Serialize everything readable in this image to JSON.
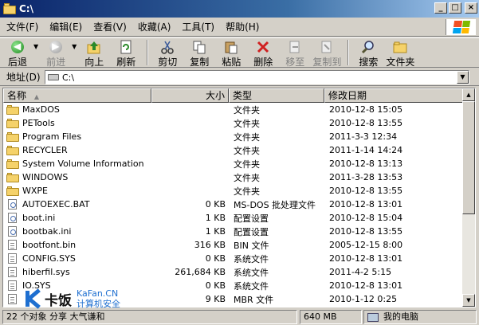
{
  "window": {
    "title": "C:\\"
  },
  "menu": [
    "文件(F)",
    "编辑(E)",
    "查看(V)",
    "收藏(A)",
    "工具(T)",
    "帮助(H)"
  ],
  "toolbar": {
    "back": "后退",
    "forward": "前进",
    "up": "向上",
    "refresh": "刷新",
    "cut": "剪切",
    "copy": "复制",
    "paste": "粘贴",
    "delete": "删除",
    "move_to": "移至",
    "copy_to": "复制到",
    "search": "搜索",
    "folders": "文件夹"
  },
  "address": {
    "label": "地址(D)",
    "value": "C:\\"
  },
  "columns": {
    "name": "名称",
    "size": "大小",
    "type": "类型",
    "modified": "修改日期"
  },
  "files": [
    {
      "name": "MaxDOS",
      "size": "",
      "type": "文件夹",
      "date": "2010-12-8 15:05",
      "icon": "folder-icon"
    },
    {
      "name": "PETools",
      "size": "",
      "type": "文件夹",
      "date": "2010-12-8 13:55",
      "icon": "folder-icon"
    },
    {
      "name": "Program Files",
      "size": "",
      "type": "文件夹",
      "date": "2011-3-3 12:34",
      "icon": "folder-icon"
    },
    {
      "name": "RECYCLER",
      "size": "",
      "type": "文件夹",
      "date": "2011-1-14 14:24",
      "icon": "folder-icon"
    },
    {
      "name": "System Volume Information",
      "size": "",
      "type": "文件夹",
      "date": "2010-12-8 13:13",
      "icon": "folder-icon"
    },
    {
      "name": "WINDOWS",
      "size": "",
      "type": "文件夹",
      "date": "2011-3-28 13:53",
      "icon": "folder-icon"
    },
    {
      "name": "WXPE",
      "size": "",
      "type": "文件夹",
      "date": "2010-12-8 13:55",
      "icon": "folder-icon"
    },
    {
      "name": "AUTOEXEC.BAT",
      "size": "0 KB",
      "type": "MS-DOS 批处理文件",
      "date": "2010-12-8 13:01",
      "icon": "batch-file-icon"
    },
    {
      "name": "boot.ini",
      "size": "1 KB",
      "type": "配置设置",
      "date": "2010-12-8 15:04",
      "icon": "config-file-icon"
    },
    {
      "name": "bootbak.ini",
      "size": "1 KB",
      "type": "配置设置",
      "date": "2010-12-8 13:55",
      "icon": "config-file-icon"
    },
    {
      "name": "bootfont.bin",
      "size": "316 KB",
      "type": "BIN 文件",
      "date": "2005-12-15 8:00",
      "icon": "file-icon"
    },
    {
      "name": "CONFIG.SYS",
      "size": "0 KB",
      "type": "系统文件",
      "date": "2010-12-8 13:01",
      "icon": "file-icon"
    },
    {
      "name": "hiberfil.sys",
      "size": "261,684 KB",
      "type": "系统文件",
      "date": "2011-4-2 5:15",
      "icon": "file-icon"
    },
    {
      "name": "IO.SYS",
      "size": "0 KB",
      "type": "系统文件",
      "date": "2010-12-8 13:01",
      "icon": "file-icon"
    },
    {
      "name": "",
      "size": "9 KB",
      "type": "MBR 文件",
      "date": "2010-1-12 0:25",
      "icon": "file-icon"
    }
  ],
  "status": {
    "left": "22 个对象 分享 大气谦和",
    "size": "640 MB",
    "location": "我的电脑"
  },
  "watermark": {
    "cn": "卡饭",
    "en": "KaFan.CN",
    "sub": "计算机安全"
  }
}
